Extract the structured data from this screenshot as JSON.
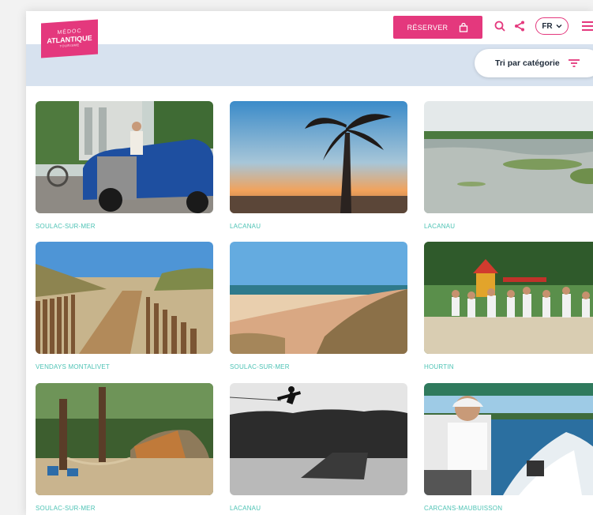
{
  "header": {
    "logo": {
      "line1": "MÉDOC",
      "line2": "ATLANTIQUE",
      "line3": "TOURISME"
    },
    "reserve_label": "RÉSERVER",
    "language": "FR",
    "icons": [
      "bag-icon",
      "search-icon",
      "share-icon",
      "chevron-down-icon",
      "menu-icon"
    ]
  },
  "filter": {
    "sort_label": "Tri par catégorie",
    "icon": "filter-icon"
  },
  "colors": {
    "brand": "#e4387d",
    "accent": "#4ec3b5",
    "band": "#d7e2ef",
    "text": "#1f2b3a"
  },
  "grid": {
    "cards": [
      {
        "caption": "SOULAC-SUR-MER",
        "scene": "vintage-car"
      },
      {
        "caption": "LACANAU",
        "scene": "palm-sunset"
      },
      {
        "caption": "LACANAU",
        "scene": "marsh-lake"
      },
      {
        "caption": "VENDAYS MONTALIVET",
        "scene": "dune-boardwalk"
      },
      {
        "caption": "SOULAC-SUR-MER",
        "scene": "beach-dune"
      },
      {
        "caption": "HOURTIN",
        "scene": "kids-playground"
      },
      {
        "caption": "SOULAC-SUR-MER",
        "scene": "camping-tent"
      },
      {
        "caption": "LACANAU",
        "scene": "wakeboard-jump"
      },
      {
        "caption": "CARCANS-MAUBUISSON",
        "scene": "motorboat"
      }
    ]
  }
}
